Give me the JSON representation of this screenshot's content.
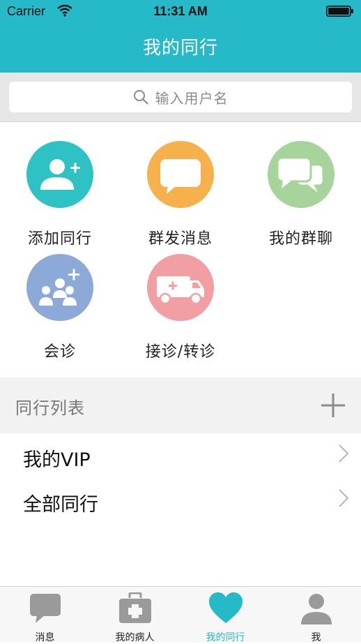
{
  "status_bar": {
    "carrier": "Carrier",
    "time": "11:31 AM"
  },
  "nav": {
    "title": "我的同行"
  },
  "search": {
    "placeholder": "输入用户名"
  },
  "actions": [
    {
      "label": "添加同行",
      "color": "#2ec2c4",
      "icon": "add-user-icon"
    },
    {
      "label": "群发消息",
      "color": "#f7b14c",
      "icon": "chat-bubble-icon"
    },
    {
      "label": "我的群聊",
      "color": "#a7d49a",
      "icon": "group-chat-icon"
    },
    {
      "label": "会诊",
      "color": "#8da9d8",
      "icon": "consultation-group-icon"
    },
    {
      "label": "接诊/转诊",
      "color": "#f19fa2",
      "icon": "ambulance-icon"
    }
  ],
  "section": {
    "title": "同行列表",
    "add_icon": "plus-icon"
  },
  "list": [
    {
      "label": "我的VIP"
    },
    {
      "label": "全部同行"
    }
  ],
  "tabs": [
    {
      "label": "消息",
      "icon": "message-icon"
    },
    {
      "label": "我的病人",
      "icon": "medical-kit-icon"
    },
    {
      "label": "我的同行",
      "icon": "heart-icon",
      "active": true
    },
    {
      "label": "我",
      "icon": "person-icon"
    }
  ],
  "colors": {
    "accent": "#26b9c7",
    "tab_inactive": "#9a9a9a"
  }
}
